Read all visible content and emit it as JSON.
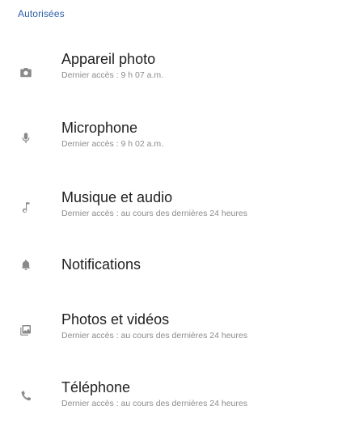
{
  "section": {
    "header": "Autorisées"
  },
  "permissions": [
    {
      "title": "Appareil photo",
      "subtitle": "Dernier accès : 9 h 07 a.m.",
      "icon": "camera-icon"
    },
    {
      "title": "Microphone",
      "subtitle": "Dernier accès : 9 h 02 a.m.",
      "icon": "microphone-icon"
    },
    {
      "title": "Musique et audio",
      "subtitle": "Dernier accès : au cours des dernières 24 heures",
      "icon": "music-note-icon"
    },
    {
      "title": "Notifications",
      "subtitle": "",
      "icon": "bell-icon"
    },
    {
      "title": "Photos et vidéos",
      "subtitle": "Dernier accès : au cours des dernières 24 heures",
      "icon": "photos-icon"
    },
    {
      "title": "Téléphone",
      "subtitle": "Dernier accès : au cours des dernières 24 heures",
      "icon": "phone-icon"
    }
  ],
  "colors": {
    "accent": "#2e5fa8",
    "icon": "#8a8a8a",
    "subtitle": "#8c8c8c"
  }
}
